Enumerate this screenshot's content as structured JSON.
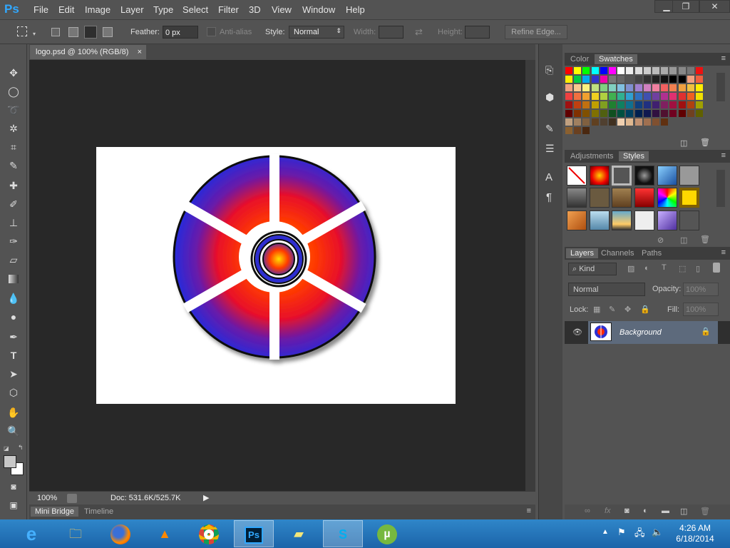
{
  "app": {
    "logo": "Ps",
    "accent": "#31a8ff"
  },
  "menus": [
    "File",
    "Edit",
    "Image",
    "Layer",
    "Type",
    "Select",
    "Filter",
    "3D",
    "View",
    "Window",
    "Help"
  ],
  "window_controls": {
    "minimize": "▁",
    "restore": "❐",
    "close": "✕"
  },
  "options_bar": {
    "feather_label": "Feather:",
    "feather_value": "0 px",
    "antialias_label": "Anti-alias",
    "style_label": "Style:",
    "style_value": "Normal",
    "width_label": "Width:",
    "height_label": "Height:",
    "refine_edge_label": "Refine Edge..."
  },
  "document": {
    "tab_title": "logo.psd @ 100% (RGB/8)",
    "tab_close": "×"
  },
  "status_bar": {
    "zoom": "100%",
    "doc_info": "Doc: 531.6K/525.7K"
  },
  "bottom_tabs": [
    "Mini Bridge",
    "Timeline"
  ],
  "panels": {
    "color_tab": "Color",
    "swatches_tab": "Swatches",
    "adjustments_tab": "Adjustments",
    "styles_tab": "Styles",
    "layers_tab": "Layers",
    "channels_tab": "Channels",
    "paths_tab": "Paths",
    "filter_kind": "Kind",
    "blend_mode": "Normal",
    "opacity_label": "Opacity:",
    "opacity_value": "100%",
    "lock_label": "Lock:",
    "fill_label": "Fill:",
    "fill_value": "100%",
    "layer_name": "Background"
  },
  "swatch_colors": [
    [
      "#ff0000",
      "#ffff00",
      "#00ff00",
      "#00ffff",
      "#0000ff",
      "#ff00ff",
      "#ffffff",
      "#eeeeee",
      "#dddddd",
      "#cccccc",
      "#bbbbbb",
      "#aaaaaa",
      "#999999",
      "#888888",
      "#777777",
      "#ee1111"
    ],
    [
      "#ffee00",
      "#00cc44",
      "#00aaee",
      "#3333cc",
      "#ee00aa",
      "#777777",
      "#666666",
      "#555555",
      "#444444",
      "#333333",
      "#222222",
      "#111111",
      "#000000",
      "#000000",
      "#f0a080",
      "#f06040"
    ],
    [
      "#f0a080",
      "#f8c890",
      "#f8f080",
      "#c0e080",
      "#80d080",
      "#80d0c0",
      "#80c0e0",
      "#8090d0",
      "#a080d0",
      "#d080c0",
      "#f080a0",
      "#f06060",
      "#f08050",
      "#f0a040",
      "#f0c040",
      "#ffee00"
    ],
    [
      "#f04040",
      "#f07040",
      "#f0a030",
      "#f0d020",
      "#b0d040",
      "#40b050",
      "#30b090",
      "#30a0d0",
      "#3070c0",
      "#4050b0",
      "#7040a0",
      "#b03090",
      "#e03070",
      "#e03030",
      "#f06020",
      "#f0e000"
    ],
    [
      "#a01010",
      "#c04010",
      "#c07010",
      "#c0a000",
      "#80a020",
      "#208030",
      "#108060",
      "#107090",
      "#104080",
      "#203080",
      "#402070",
      "#802060",
      "#a01040",
      "#a01010",
      "#b04010",
      "#a0a000"
    ],
    [
      "#600000",
      "#803000",
      "#805000",
      "#807000",
      "#506010",
      "#105020",
      "#005040",
      "#004060",
      "#002050",
      "#101850",
      "#301040",
      "#501030",
      "#700020",
      "#600000",
      "#704020",
      "#606000"
    ],
    [
      "#c0a080",
      "#a08060",
      "#806040",
      "#604020",
      "#504030",
      "#403020",
      "#f0d0b0",
      "#e0b890",
      "#c09070",
      "#a07050",
      "#805030",
      "#603010"
    ],
    [
      "#8a6030",
      "#6a4020",
      "#4a2810"
    ]
  ],
  "layer_preview_colors": {
    "blue": "#2e2fd0",
    "red": "#ff2a00",
    "orange": "#ff7a00"
  },
  "clock": {
    "time": "4:26 AM",
    "date": "6/18/2014"
  },
  "taskbar_apps": [
    "ie-icon",
    "file-explorer-icon",
    "firefox-icon",
    "vlc-icon",
    "chrome-icon",
    "photoshop-icon",
    "sticky-notes-icon",
    "skype-icon",
    "utorrent-icon"
  ]
}
